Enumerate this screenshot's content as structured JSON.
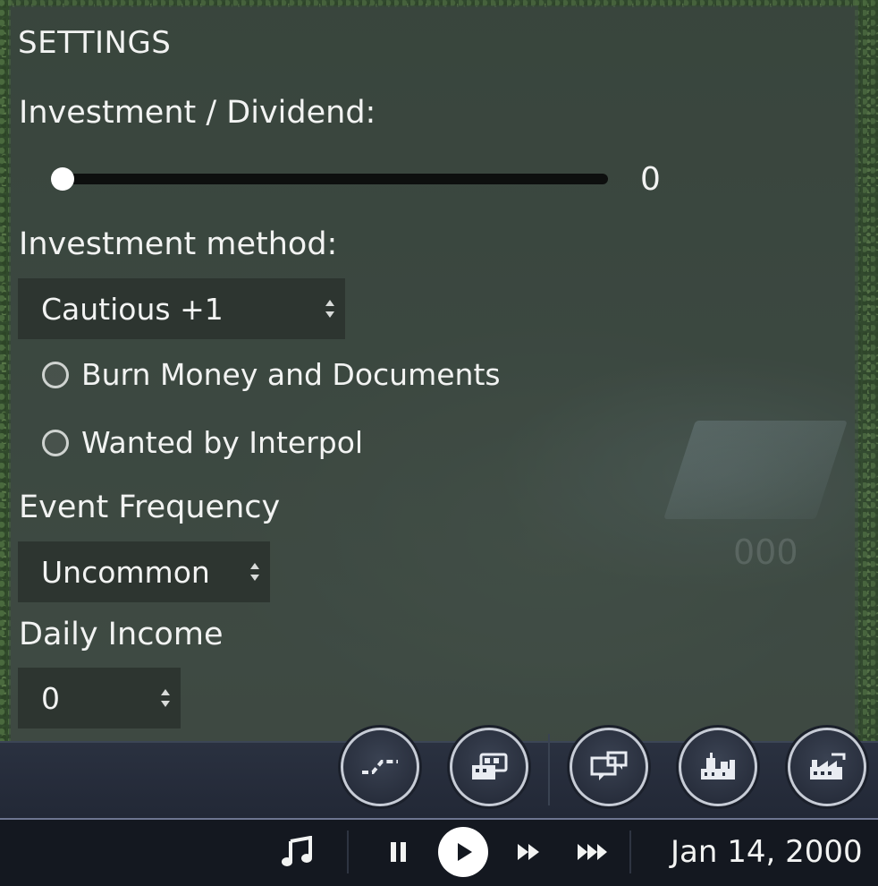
{
  "settings": {
    "title": "SETTINGS",
    "investment_dividend": {
      "label": "Investment / Dividend:",
      "value": "0",
      "slider_fraction": 0
    },
    "investment_method": {
      "label": "Investment method:",
      "selected": "Cautious +1"
    },
    "options": [
      {
        "label": "Burn Money and Documents",
        "checked": false
      },
      {
        "label": "Wanted by Interpol",
        "checked": false
      }
    ],
    "event_frequency": {
      "label": "Event Frequency",
      "selected": "Uncommon"
    },
    "daily_income": {
      "label": "Daily Income",
      "selected": "0"
    }
  },
  "toolbar": {
    "buttons": [
      {
        "icon": "route-icon"
      },
      {
        "icon": "bus-depot-icon"
      },
      {
        "icon": "messages-icon"
      },
      {
        "icon": "city-icon"
      },
      {
        "icon": "factory-icon"
      }
    ]
  },
  "statusbar": {
    "music_icon": "music-note-icon",
    "pause_icon": "pause-icon",
    "play_icon": "play-icon",
    "fast_icon": "fast-forward-icon",
    "fastest_icon": "fastest-forward-icon",
    "date": "Jan 14, 2000"
  },
  "colors": {
    "panel_bg": "#3b473f",
    "select_bg": "#2d3530",
    "toolbar_bg": "#2a3140",
    "statusbar_bg": "#141820",
    "text": "#f2f3f2"
  }
}
